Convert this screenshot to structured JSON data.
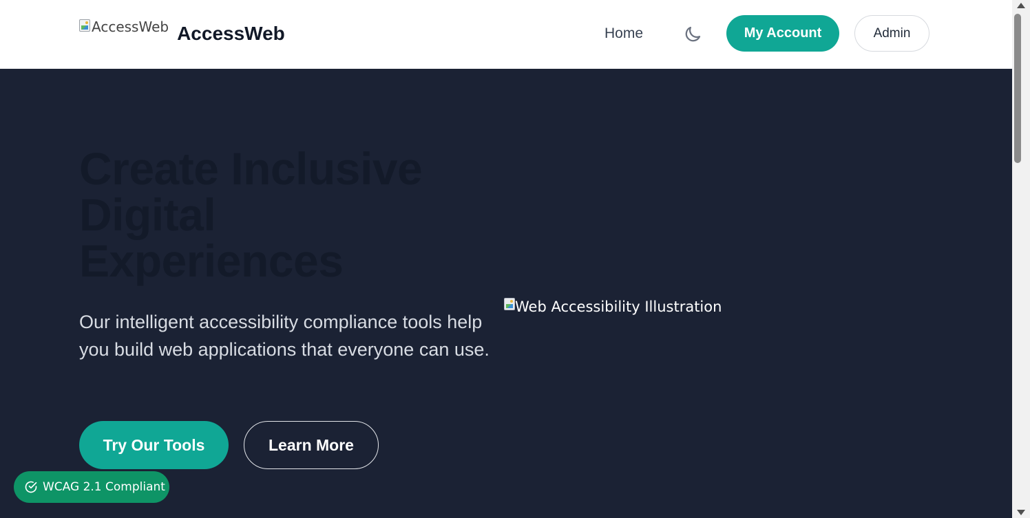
{
  "header": {
    "logo_alt": "AccessWeb",
    "brand_name": "AccessWeb",
    "nav": {
      "home_label": "Home"
    },
    "theme_toggle_icon": "moon-icon",
    "account_button_label": "My Account",
    "admin_button_label": "Admin"
  },
  "hero": {
    "title_lines": [
      "Create Inclusive",
      "Digital",
      "Experiences"
    ],
    "description": "Our intelligent accessibility compliance tools help you build web applications that everyone can use.",
    "primary_button_label": "Try Our Tools",
    "secondary_button_label": "Learn More",
    "illustration_alt": "Web Accessibility Illustration"
  },
  "badge": {
    "label": "WCAG 2.1 Compliant",
    "icon": "check-circle-icon"
  },
  "colors": {
    "accent": "#10a795",
    "hero_background": "#1b2234",
    "header_background": "#ffffff",
    "badge_background": "#0e9466"
  }
}
